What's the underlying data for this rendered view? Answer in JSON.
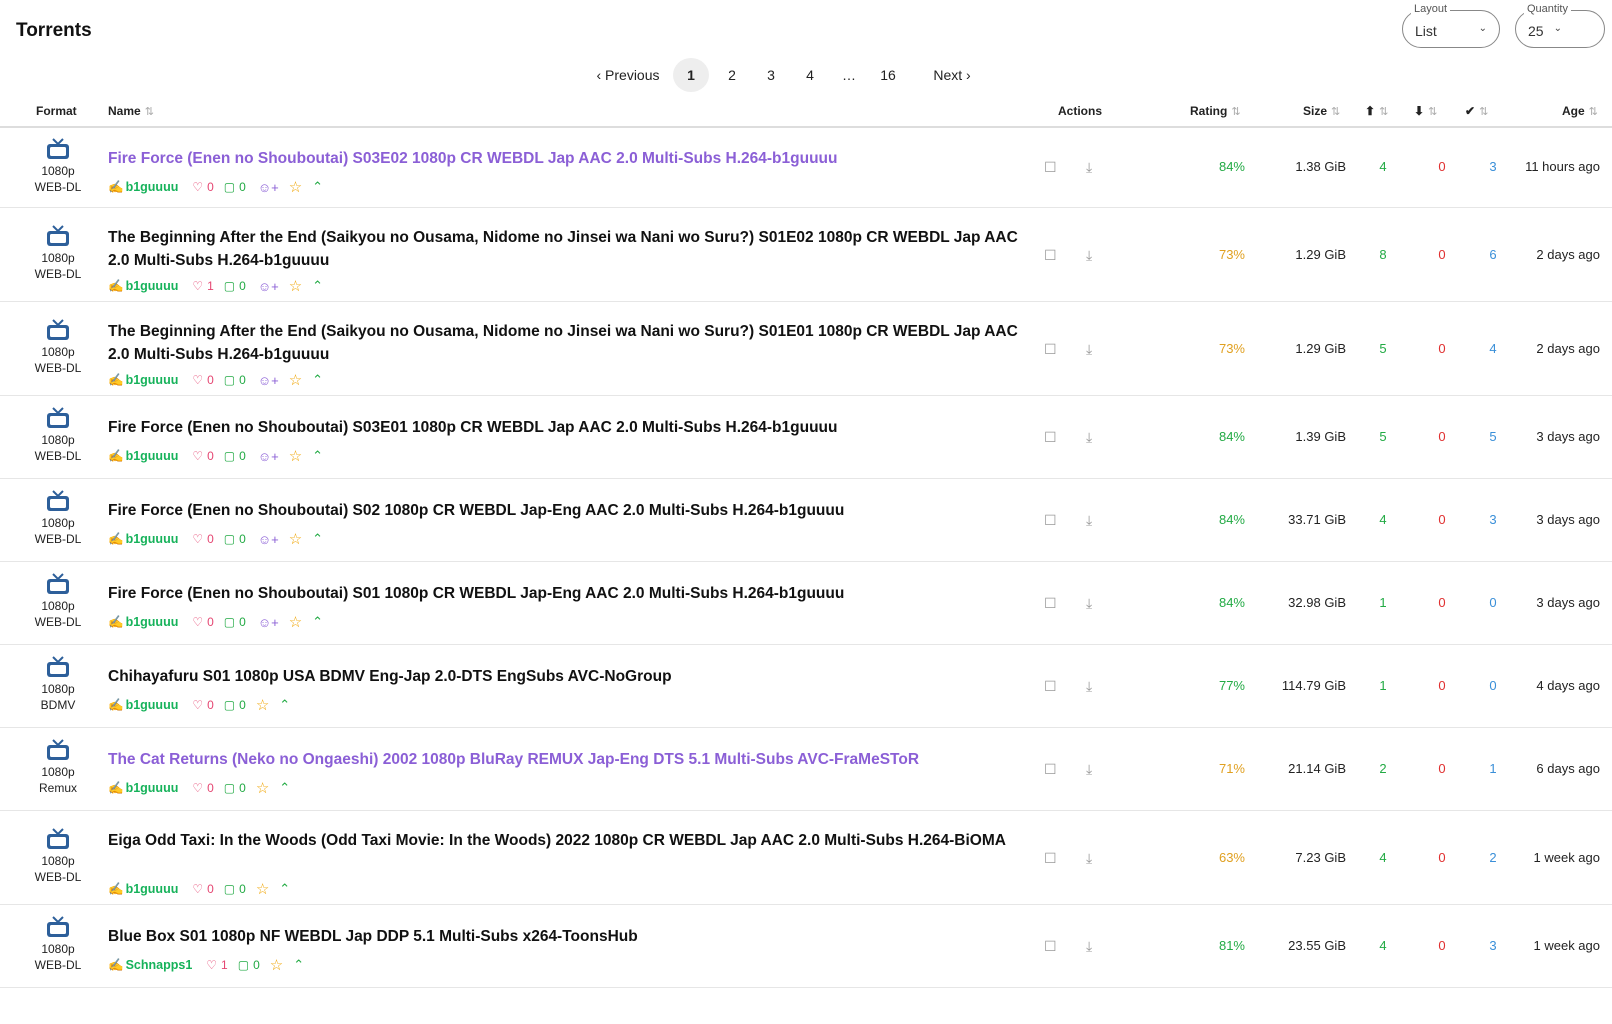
{
  "page": {
    "title": "Torrents"
  },
  "controls": {
    "layout": {
      "label": "Layout",
      "value": "List"
    },
    "quantity": {
      "label": "Quantity",
      "value": "25"
    }
  },
  "pagination": {
    "previous": "‹ Previous",
    "pages": [
      "1",
      "2",
      "3",
      "4",
      "…",
      "16"
    ],
    "current": "1",
    "next": "Next ›"
  },
  "columns": {
    "format": "Format",
    "name": "Name",
    "actions": "Actions",
    "rating": "Rating",
    "size": "Size",
    "age": "Age"
  },
  "colors": {
    "purple_title": "#8b5fd6",
    "green": "#22aa44",
    "red": "#e03030",
    "blue": "#3a8fd8",
    "amber": "#e0a020"
  },
  "rows": [
    {
      "res": "1080p",
      "type": "WEB-DL",
      "name": "Fire Force (Enen no Shouboutai) S03E02 1080p CR WEBDL Jap AAC 2.0 Multi-Subs H.264-b1guuuu",
      "highlight": true,
      "uploader": "b1guuuu",
      "likes": "0",
      "comments": "0",
      "follow": true,
      "rating": "84%",
      "rating_color": "green",
      "size": "1.38 GiB",
      "seeders": "4",
      "leechers": "0",
      "completed": "3",
      "age": "11 hours ago"
    },
    {
      "res": "1080p",
      "type": "WEB-DL",
      "name": "The Beginning After the End (Saikyou no Ousama, Nidome no Jinsei wa Nani wo Suru?) S01E02 1080p CR WEBDL Jap AAC 2.0 Multi-Subs H.264-b1guuuu",
      "highlight": false,
      "uploader": "b1guuuu",
      "likes": "1",
      "comments": "0",
      "follow": true,
      "rating": "73%",
      "rating_color": "amber",
      "size": "1.29 GiB",
      "seeders": "8",
      "leechers": "0",
      "completed": "6",
      "age": "2 days ago"
    },
    {
      "res": "1080p",
      "type": "WEB-DL",
      "name": "The Beginning After the End (Saikyou no Ousama, Nidome no Jinsei wa Nani wo Suru?) S01E01 1080p CR WEBDL Jap AAC 2.0 Multi-Subs H.264-b1guuuu",
      "highlight": false,
      "uploader": "b1guuuu",
      "likes": "0",
      "comments": "0",
      "follow": true,
      "rating": "73%",
      "rating_color": "amber",
      "size": "1.29 GiB",
      "seeders": "5",
      "leechers": "0",
      "completed": "4",
      "age": "2 days ago"
    },
    {
      "res": "1080p",
      "type": "WEB-DL",
      "name": "Fire Force (Enen no Shouboutai) S03E01 1080p CR WEBDL Jap AAC 2.0 Multi-Subs H.264-b1guuuu",
      "highlight": false,
      "uploader": "b1guuuu",
      "likes": "0",
      "comments": "0",
      "follow": true,
      "rating": "84%",
      "rating_color": "green",
      "size": "1.39 GiB",
      "seeders": "5",
      "leechers": "0",
      "completed": "5",
      "age": "3 days ago"
    },
    {
      "res": "1080p",
      "type": "WEB-DL",
      "name": "Fire Force (Enen no Shouboutai) S02 1080p CR WEBDL Jap-Eng AAC 2.0 Multi-Subs H.264-b1guuuu",
      "highlight": false,
      "uploader": "b1guuuu",
      "likes": "0",
      "comments": "0",
      "follow": true,
      "rating": "84%",
      "rating_color": "green",
      "size": "33.71 GiB",
      "seeders": "4",
      "leechers": "0",
      "completed": "3",
      "age": "3 days ago"
    },
    {
      "res": "1080p",
      "type": "WEB-DL",
      "name": "Fire Force (Enen no Shouboutai) S01 1080p CR WEBDL Jap-Eng AAC 2.0 Multi-Subs H.264-b1guuuu",
      "highlight": false,
      "uploader": "b1guuuu",
      "likes": "0",
      "comments": "0",
      "follow": true,
      "rating": "84%",
      "rating_color": "green",
      "size": "32.98 GiB",
      "seeders": "1",
      "leechers": "0",
      "completed": "0",
      "age": "3 days ago"
    },
    {
      "res": "1080p",
      "type": "BDMV",
      "name": "Chihayafuru S01 1080p USA BDMV Eng-Jap 2.0-DTS EngSubs AVC-NoGroup",
      "highlight": false,
      "uploader": "b1guuuu",
      "likes": "0",
      "comments": "0",
      "follow": false,
      "rating": "77%",
      "rating_color": "green",
      "size": "114.79 GiB",
      "seeders": "1",
      "leechers": "0",
      "completed": "0",
      "age": "4 days ago"
    },
    {
      "res": "1080p",
      "type": "Remux",
      "name": "The Cat Returns (Neko no Ongaeshi) 2002 1080p BluRay REMUX Jap-Eng DTS 5.1 Multi-Subs AVC-FraMeSToR",
      "highlight": true,
      "uploader": "b1guuuu",
      "likes": "0",
      "comments": "0",
      "follow": false,
      "rating": "71%",
      "rating_color": "amber",
      "size": "21.14 GiB",
      "seeders": "2",
      "leechers": "0",
      "completed": "1",
      "age": "6 days ago"
    },
    {
      "res": "1080p",
      "type": "WEB-DL",
      "name": "Eiga Odd Taxi: In the Woods (Odd Taxi Movie: In the Woods) 2022 1080p CR WEBDL Jap AAC 2.0 Multi-Subs H.264-BiOMA",
      "highlight": false,
      "uploader": "b1guuuu",
      "likes": "0",
      "comments": "0",
      "follow": false,
      "rating": "63%",
      "rating_color": "amber",
      "size": "7.23 GiB",
      "seeders": "4",
      "leechers": "0",
      "completed": "2",
      "age": "1 week ago"
    },
    {
      "res": "1080p",
      "type": "WEB-DL",
      "name": "Blue Box S01 1080p NF WEBDL Jap DDP 5.1 Multi-Subs x264-ToonsHub",
      "highlight": false,
      "uploader": "Schnapps1",
      "likes": "1",
      "comments": "0",
      "follow": false,
      "rating": "81%",
      "rating_color": "green",
      "size": "23.55 GiB",
      "seeders": "4",
      "leechers": "0",
      "completed": "3",
      "age": "1 week ago"
    }
  ]
}
